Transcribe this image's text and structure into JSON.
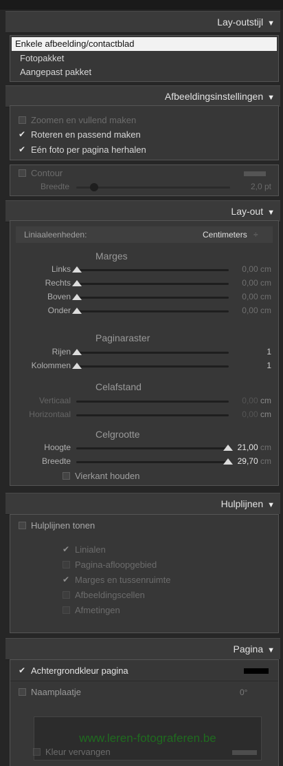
{
  "layout_style": {
    "title": "Lay-outstijl",
    "options": [
      "Enkele afbeelding/contactblad",
      "Fotopakket",
      "Aangepast pakket"
    ],
    "selected_index": 0
  },
  "image_settings": {
    "title": "Afbeeldingsinstellingen",
    "checks": [
      {
        "label": "Zoomen en vullend maken",
        "checked": false
      },
      {
        "label": "Roteren en passend maken",
        "checked": true
      },
      {
        "label": "Eén foto per pagina herhalen",
        "checked": true
      }
    ],
    "stroke": {
      "label": "Contour",
      "checked": false,
      "width_label": "Breedte",
      "width_value": "2,0 pt",
      "width_fraction": 0.2
    }
  },
  "layout": {
    "title": "Lay-out",
    "ruler_units_label": "Liniaaleenheden:",
    "ruler_units_value": "Centimeters",
    "ruler_units_arrow": "÷",
    "margins_title": "Marges",
    "margins": [
      {
        "label": "Links",
        "value": "0,00",
        "unit": "cm",
        "fraction": 0
      },
      {
        "label": "Rechts",
        "value": "0,00",
        "unit": "cm",
        "fraction": 0
      },
      {
        "label": "Boven",
        "value": "0,00",
        "unit": "cm",
        "fraction": 0
      },
      {
        "label": "Onder",
        "value": "0,00",
        "unit": "cm",
        "fraction": 0
      }
    ],
    "grid_title": "Paginaraster",
    "grid": [
      {
        "label": "Rijen",
        "value": "1",
        "fraction": 0
      },
      {
        "label": "Kolommen",
        "value": "1",
        "fraction": 0
      }
    ],
    "spacing_title": "Celafstand",
    "spacing": [
      {
        "label": "Verticaal",
        "value": "0,00",
        "unit": "cm"
      },
      {
        "label": "Horizontaal",
        "value": "0,00",
        "unit": "cm"
      }
    ],
    "size_title": "Celgrootte",
    "size": [
      {
        "label": "Hoogte",
        "value": "21,00",
        "unit": "cm",
        "fraction": 1
      },
      {
        "label": "Breedte",
        "value": "29,70",
        "unit": "cm",
        "fraction": 1
      }
    ],
    "keep_square": {
      "label": "Vierkant houden",
      "checked": false
    }
  },
  "guides": {
    "title": "Hulplijnen",
    "show": {
      "label": "Hulplijnen tonen",
      "checked": false
    },
    "items": [
      {
        "label": "Linialen",
        "checked": true
      },
      {
        "label": "Pagina-afloopgebied",
        "checked": false
      },
      {
        "label": "Marges en tussenruimte",
        "checked": true
      },
      {
        "label": "Afbeeldingscellen",
        "checked": false
      },
      {
        "label": "Afmetingen",
        "checked": false
      }
    ]
  },
  "page": {
    "title": "Pagina",
    "background": {
      "label": "Achtergrondkleur pagina",
      "checked": true,
      "color": "#000000"
    },
    "identity_plate": {
      "label": "Naamplaatje",
      "checked": false,
      "angle": "0°",
      "preview_text": "www.leren-fotograferen.be",
      "preview_color": "#1f6b1f"
    },
    "override_color": {
      "label": "Kleur vervangen",
      "checked": false
    }
  },
  "colors": {
    "accent": "#f2f2f2",
    "panel": "#373737",
    "header": "#3a3a3a"
  }
}
